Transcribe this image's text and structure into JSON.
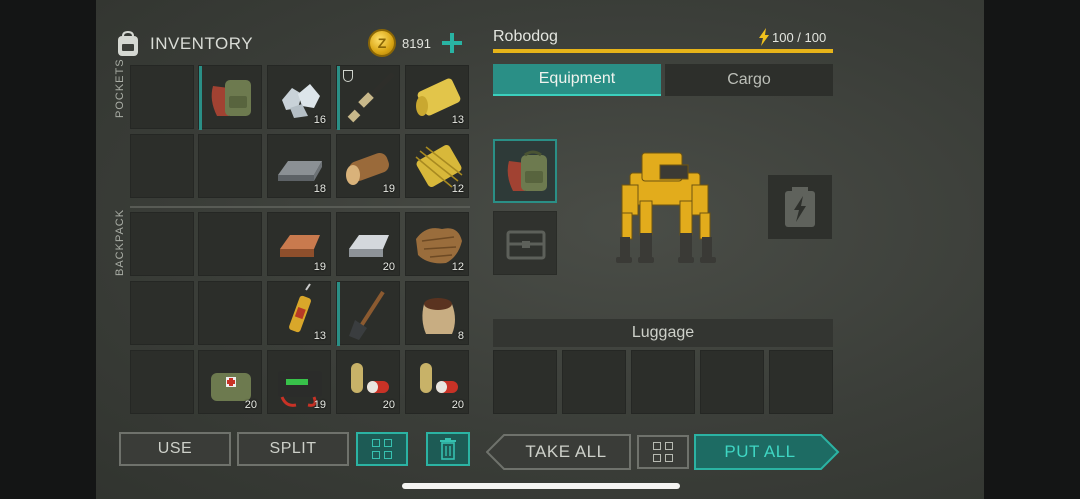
{
  "inventory": {
    "title": "INVENTORY",
    "coins": "8191",
    "coin_symbol": "Z",
    "pockets_label": "POCKETS",
    "backpack_label": "BACKPACK",
    "slots": [
      {
        "item": "empty",
        "count": ""
      },
      {
        "item": "backpack-icon",
        "count": ""
      },
      {
        "item": "ore-chunks-icon",
        "count": "16"
      },
      {
        "item": "rifle-icon",
        "count": ""
      },
      {
        "item": "fabric-roll-icon",
        "count": "13"
      },
      {
        "item": "empty",
        "count": ""
      },
      {
        "item": "empty",
        "count": ""
      },
      {
        "item": "iron-bar-icon",
        "count": "18"
      },
      {
        "item": "log-icon",
        "count": "19"
      },
      {
        "item": "mesh-roll-icon",
        "count": "12"
      },
      {
        "item": "empty",
        "count": ""
      },
      {
        "item": "empty",
        "count": ""
      },
      {
        "item": "copper-ingot-icon",
        "count": "19"
      },
      {
        "item": "steel-ingot-icon",
        "count": "20"
      },
      {
        "item": "leather-icon",
        "count": "12"
      },
      {
        "item": "empty",
        "count": ""
      },
      {
        "item": "empty",
        "count": ""
      },
      {
        "item": "syringe-icon",
        "count": "13"
      },
      {
        "item": "shovel-icon",
        "count": ""
      },
      {
        "item": "seed-sack-icon",
        "count": "8"
      },
      {
        "item": "empty",
        "count": ""
      },
      {
        "item": "medkit-bag-icon",
        "count": "20"
      },
      {
        "item": "car-battery-icon",
        "count": "19"
      },
      {
        "item": "pill-capsule-icon",
        "count": "20"
      },
      {
        "item": "pill-capsule-icon",
        "count": "20"
      }
    ]
  },
  "buttons": {
    "use": "USE",
    "split": "SPLIT",
    "take_all": "TAKE ALL",
    "put_all": "PUT ALL"
  },
  "robot": {
    "name": "Robodog",
    "energy": "100 / 100",
    "tabs": [
      "Equipment",
      "Cargo"
    ],
    "luggage_label": "Luggage"
  },
  "colors": {
    "accent_teal": "#2a8f86",
    "energy_yellow": "#e7b419",
    "coin_gold": "#d9a514"
  }
}
